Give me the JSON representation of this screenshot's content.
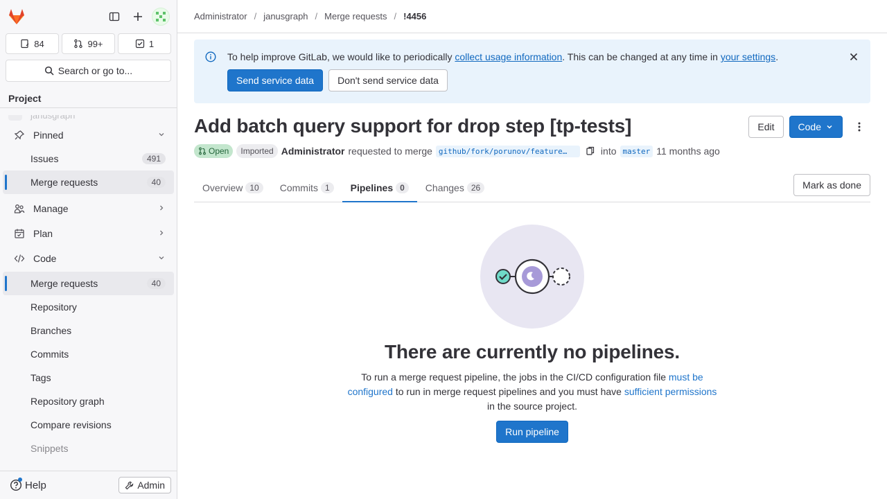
{
  "sidebar": {
    "counters": {
      "issues": "84",
      "merge_requests": "99+",
      "todos": "1"
    },
    "search_label": "Search or go to...",
    "section_title": "Project",
    "ghost_item": "janusgraph",
    "items": [
      {
        "label": "Pinned"
      },
      {
        "label": "Issues",
        "badge": "491"
      },
      {
        "label": "Merge requests",
        "badge": "40"
      },
      {
        "label": "Manage"
      },
      {
        "label": "Plan"
      },
      {
        "label": "Code"
      },
      {
        "label": "Merge requests",
        "badge": "40"
      },
      {
        "label": "Repository"
      },
      {
        "label": "Branches"
      },
      {
        "label": "Commits"
      },
      {
        "label": "Tags"
      },
      {
        "label": "Repository graph"
      },
      {
        "label": "Compare revisions"
      },
      {
        "label": "Snippets"
      }
    ],
    "help_label": "Help",
    "admin_label": "Admin"
  },
  "breadcrumb": [
    "Administrator",
    "janusgraph",
    "Merge requests",
    "!4456"
  ],
  "alert": {
    "text_before": "To help improve GitLab, we would like to periodically ",
    "link1": "collect usage information",
    "text_mid": ". This can be changed at any time in ",
    "link2": "your settings",
    "text_after": ".",
    "primary_btn": "Send service data",
    "secondary_btn": "Don't send service data"
  },
  "mr": {
    "title": "Add batch query support for drop step [tp-tests]",
    "edit_label": "Edit",
    "code_label": "Code",
    "status": "Open",
    "imported": "Imported",
    "author": "Administrator",
    "requested_text": "requested to merge",
    "source_branch": "github/fork/porunov/feature…",
    "into_text": "into",
    "target_branch": "master",
    "time": "11 months ago"
  },
  "tabs": [
    {
      "label": "Overview",
      "count": "10"
    },
    {
      "label": "Commits",
      "count": "1"
    },
    {
      "label": "Pipelines",
      "count": "0"
    },
    {
      "label": "Changes",
      "count": "26"
    }
  ],
  "mark_done_label": "Mark as done",
  "empty_state": {
    "heading": "There are currently no pipelines.",
    "text1": "To run a merge request pipeline, the jobs in the CI/CD configuration file ",
    "link1": "must be configured",
    "text2": " to run in merge request pipelines and you must have ",
    "link2": "sufficient permissions",
    "text3": " in the source project.",
    "button": "Run pipeline"
  },
  "colors": {
    "accent": "#1f75cb",
    "open": "#c3e6cd",
    "illustration_bg": "#e8e6f2"
  }
}
